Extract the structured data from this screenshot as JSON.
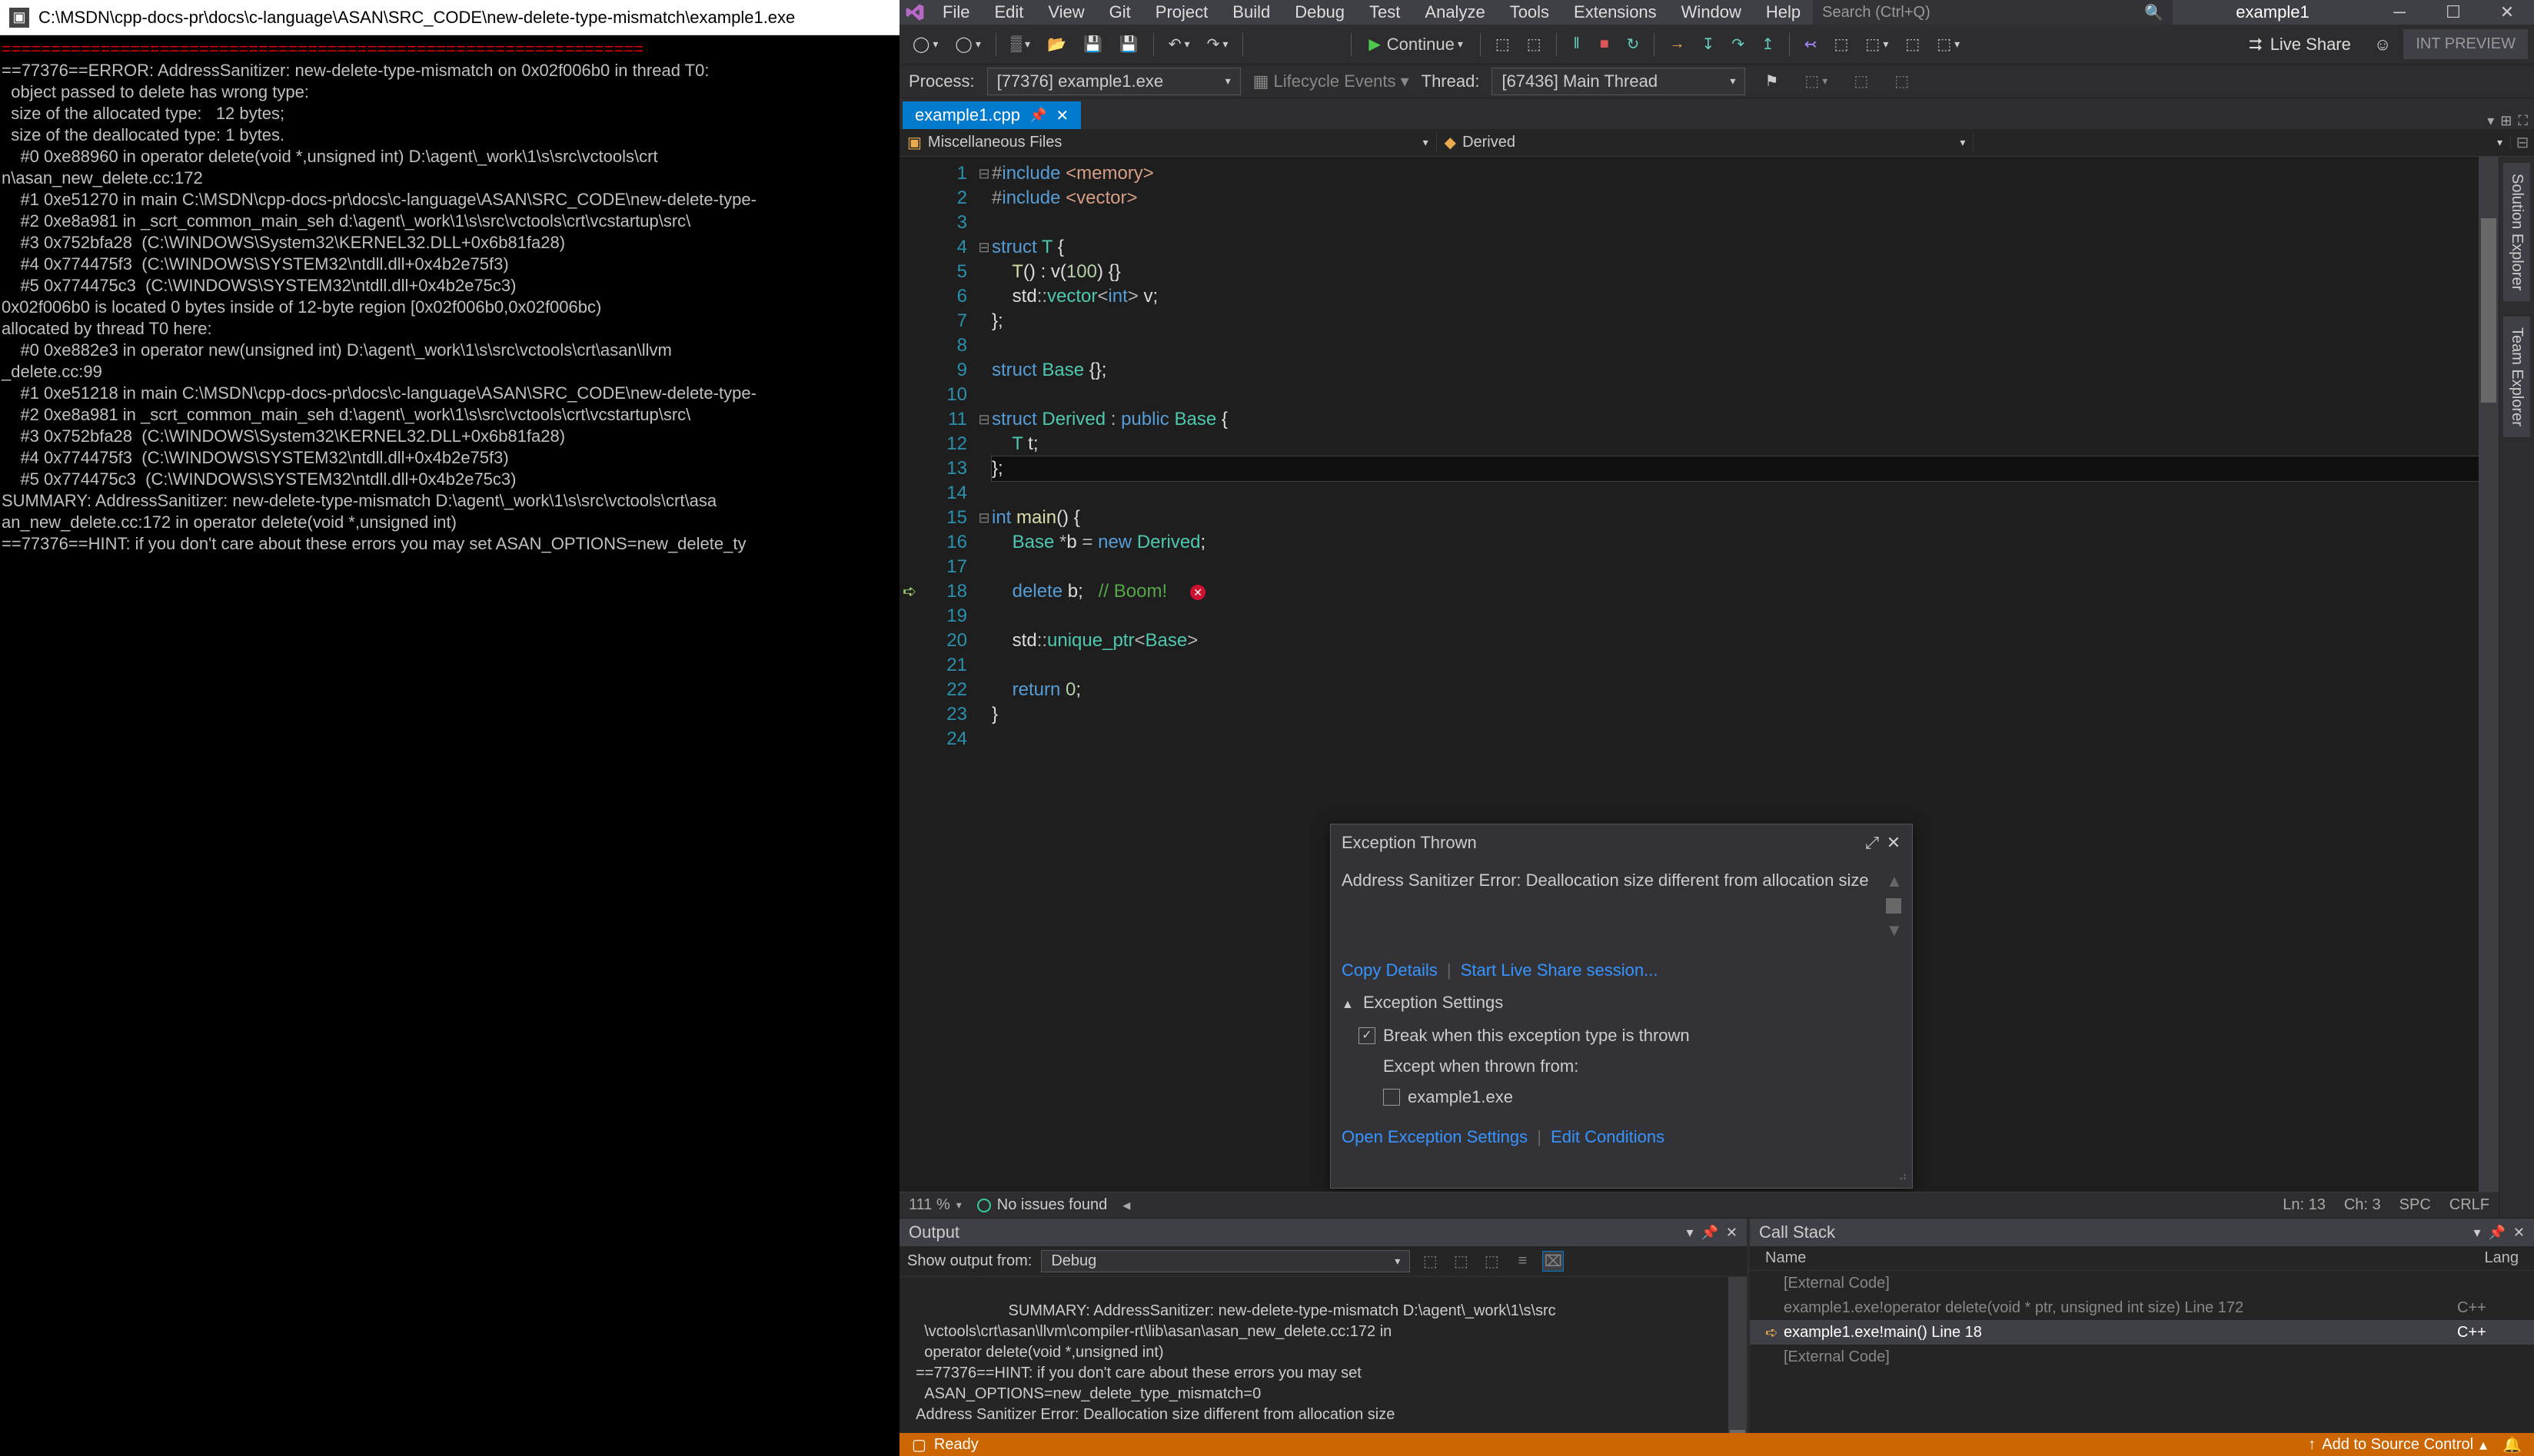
{
  "console": {
    "title": "C:\\MSDN\\cpp-docs-pr\\docs\\c-language\\ASAN\\SRC_CODE\\new-delete-type-mismatch\\example1.exe",
    "lines": [
      "=================================================================",
      "==77376==ERROR: AddressSanitizer: new-delete-type-mismatch on 0x02f006b0 in thread T0:",
      "  object passed to delete has wrong type:",
      "  size of the allocated type:   12 bytes;",
      "  size of the deallocated type: 1 bytes.",
      "    #0 0xe88960 in operator delete(void *,unsigned int) D:\\agent\\_work\\1\\s\\src\\vctools\\crt",
      "n\\asan_new_delete.cc:172",
      "    #1 0xe51270 in main C:\\MSDN\\cpp-docs-pr\\docs\\c-language\\ASAN\\SRC_CODE\\new-delete-type-",
      "    #2 0xe8a981 in _scrt_common_main_seh d:\\agent\\_work\\1\\s\\src\\vctools\\crt\\vcstartup\\src\\",
      "    #3 0x752bfa28  (C:\\WINDOWS\\System32\\KERNEL32.DLL+0x6b81fa28)",
      "    #4 0x774475f3  (C:\\WINDOWS\\SYSTEM32\\ntdll.dll+0x4b2e75f3)",
      "    #5 0x774475c3  (C:\\WINDOWS\\SYSTEM32\\ntdll.dll+0x4b2e75c3)",
      "",
      "0x02f006b0 is located 0 bytes inside of 12-byte region [0x02f006b0,0x02f006bc)",
      "allocated by thread T0 here:",
      "    #0 0xe882e3 in operator new(unsigned int) D:\\agent\\_work\\1\\s\\src\\vctools\\crt\\asan\\llvm",
      "_delete.cc:99",
      "    #1 0xe51218 in main C:\\MSDN\\cpp-docs-pr\\docs\\c-language\\ASAN\\SRC_CODE\\new-delete-type-",
      "    #2 0xe8a981 in _scrt_common_main_seh d:\\agent\\_work\\1\\s\\src\\vctools\\crt\\vcstartup\\src\\",
      "    #3 0x752bfa28  (C:\\WINDOWS\\System32\\KERNEL32.DLL+0x6b81fa28)",
      "    #4 0x774475f3  (C:\\WINDOWS\\SYSTEM32\\ntdll.dll+0x4b2e75f3)",
      "    #5 0x774475c3  (C:\\WINDOWS\\SYSTEM32\\ntdll.dll+0x4b2e75c3)",
      "",
      "SUMMARY: AddressSanitizer: new-delete-type-mismatch D:\\agent\\_work\\1\\s\\src\\vctools\\crt\\asa",
      "an_new_delete.cc:172 in operator delete(void *,unsigned int)",
      "==77376==HINT: if you don't care about these errors you may set ASAN_OPTIONS=new_delete_ty"
    ]
  },
  "vs": {
    "menus": [
      "File",
      "Edit",
      "View",
      "Git",
      "Project",
      "Build",
      "Debug",
      "Test",
      "Analyze",
      "Tools",
      "Extensions",
      "Window",
      "Help"
    ],
    "search_ph": "Search (Ctrl+Q)",
    "solution": "example1",
    "continue_label": "Continue",
    "live_share": "Live Share",
    "int_preview": "INT PREVIEW",
    "dbg": {
      "process_label": "Process:",
      "process_value": "[77376] example1.exe",
      "lifecycle": "Lifecycle Events",
      "thread_label": "Thread:",
      "thread_value": "[67436] Main Thread"
    },
    "tab": {
      "name": "example1.cpp"
    },
    "nav": {
      "left": "Miscellaneous Files",
      "right": "Derived"
    },
    "code_lines": [
      {
        "n": 1,
        "html": "<span class='pp'>#</span><span class='pp2'>include</span> <span class='str'>&lt;memory&gt;</span>"
      },
      {
        "n": 2,
        "html": "<span class='pp'>#</span><span class='pp2'>include</span> <span class='str'>&lt;vector&gt;</span>"
      },
      {
        "n": 3,
        "html": ""
      },
      {
        "n": 4,
        "html": "<span class='kw'>struct</span> <span class='typ'>T</span> <span class='txt'>{</span>"
      },
      {
        "n": 5,
        "html": "    <span class='fn'>T</span><span class='txt'>() : </span><span class='txt'>v</span><span class='txt'>(</span><span class='num'>100</span><span class='txt'>) {}</span>"
      },
      {
        "n": 6,
        "html": "    <span class='txt'>std</span><span class='op'>::</span><span class='typ'>vector</span><span class='op'>&lt;</span><span class='kw'>int</span><span class='op'>&gt;</span> <span class='txt'>v;</span>"
      },
      {
        "n": 7,
        "html": "<span class='txt'>};</span>"
      },
      {
        "n": 8,
        "html": ""
      },
      {
        "n": 9,
        "html": "<span class='kw'>struct</span> <span class='typ'>Base</span> <span class='txt'>{};</span>"
      },
      {
        "n": 10,
        "html": ""
      },
      {
        "n": 11,
        "html": "<span class='kw'>struct</span> <span class='typ'>Derived</span> <span class='op'>:</span> <span class='kw'>public</span> <span class='typ'>Base</span> <span class='txt'>{</span>"
      },
      {
        "n": 12,
        "html": "    <span class='typ'>T</span> <span class='txt'>t;</span>"
      },
      {
        "n": 13,
        "html": "<span class='txt'>};</span>",
        "current": true
      },
      {
        "n": 14,
        "html": ""
      },
      {
        "n": 15,
        "html": "<span class='kw'>int</span> <span class='fn'>main</span><span class='txt'>() {</span>"
      },
      {
        "n": 16,
        "html": "    <span class='typ'>Base</span> <span class='op'>*</span><span class='txt'>b</span> <span class='op'>=</span> <span class='kw'>new</span> <span class='typ'>Derived</span><span class='txt'>;</span>"
      },
      {
        "n": 17,
        "html": ""
      },
      {
        "n": 18,
        "html": "    <span class='kw'>delete</span> <span class='txt'>b;</span>   <span class='cmt'>// Boom!</span><span class='err-dot'>✕</span>",
        "bp": true
      },
      {
        "n": 19,
        "html": ""
      },
      {
        "n": 20,
        "html": "    <span class='txt'>std</span><span class='op'>::</span><span class='typ'>unique_ptr</span><span class='op'>&lt;</span><span class='typ'>Base</span><span class='op'>&gt;</span>"
      },
      {
        "n": 21,
        "html": ""
      },
      {
        "n": 22,
        "html": "    <span class='kw'>return</span> <span class='num'>0</span><span class='txt'>;</span>"
      },
      {
        "n": 23,
        "html": "<span class='txt'>}</span>"
      },
      {
        "n": 24,
        "html": ""
      }
    ],
    "exc": {
      "title": "Exception Thrown",
      "msg": "Address Sanitizer Error: Deallocation size different from allocation size",
      "copy": "Copy Details",
      "live": "Start Live Share session...",
      "settings": "Exception Settings",
      "break_when": "Break when this exception type is thrown",
      "except_from": "Except when thrown from:",
      "except_target": "example1.exe",
      "open_settings": "Open Exception Settings",
      "edit_cond": "Edit Conditions"
    },
    "ed_status": {
      "zoom": "111 %",
      "issues": "No issues found",
      "ln": "Ln: 13",
      "ch": "Ch: 3",
      "spc": "SPC",
      "crlf": "CRLF"
    },
    "output": {
      "title": "Output",
      "show_from": "Show output from:",
      "source": "Debug",
      "text": "  SUMMARY: AddressSanitizer: new-delete-type-mismatch D:\\agent\\_work\\1\\s\\src\n    \\vctools\\crt\\asan\\llvm\\compiler-rt\\lib\\asan\\asan_new_delete.cc:172 in\n    operator delete(void *,unsigned int)\n  ==77376==HINT: if you don't care about these errors you may set\n    ASAN_OPTIONS=new_delete_type_mismatch=0\n  Address Sanitizer Error: Deallocation size different from allocation size\n"
    },
    "callstack": {
      "title": "Call Stack",
      "col_name": "Name",
      "col_lang": "Lang",
      "rows": [
        {
          "name": "[External Code]",
          "lang": "",
          "dim": true
        },
        {
          "name": "example1.exe!operator delete(void * ptr, unsigned int size) Line 172",
          "lang": "C++",
          "dim": true
        },
        {
          "name": "example1.exe!main() Line 18",
          "lang": "C++",
          "active": true
        },
        {
          "name": "[External Code]",
          "lang": "",
          "dim": true
        }
      ]
    },
    "status": {
      "ready": "Ready",
      "add_sc": "Add to Source Control"
    },
    "rail": [
      "Solution Explorer",
      "Team Explorer"
    ]
  }
}
